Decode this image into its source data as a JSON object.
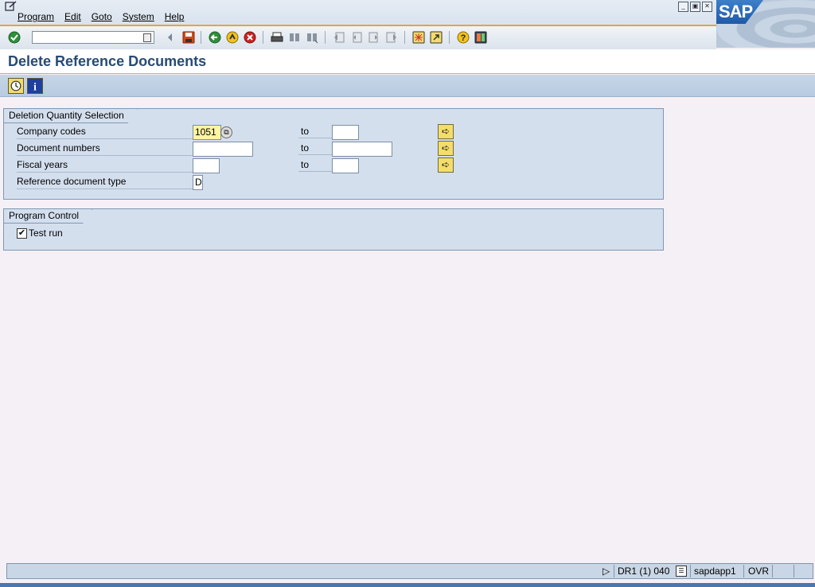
{
  "menu": {
    "items": [
      "Program",
      "Edit",
      "Goto",
      "System",
      "Help"
    ]
  },
  "logo": {
    "text": "SAP"
  },
  "toolbar": {
    "command_field_value": "",
    "icons": [
      "enter-icon",
      "back-arrow-icon",
      "save-icon",
      "back-icon",
      "exit-icon",
      "cancel-icon",
      "print-icon",
      "find-icon",
      "find-next-icon",
      "first-page-icon",
      "previous-page-icon",
      "next-page-icon",
      "last-page-icon",
      "create-session-icon",
      "shortcut-icon",
      "help-icon",
      "layout-menu-icon"
    ]
  },
  "page": {
    "title": "Delete Reference Documents"
  },
  "app_toolbar": {
    "icons": [
      "execute-icon",
      "info-icon"
    ]
  },
  "selection": {
    "title": "Deletion Quantity Selection",
    "rows": [
      {
        "label": "Company codes",
        "from": "1051",
        "to_label": "to",
        "to": ""
      },
      {
        "label": "Document numbers",
        "from": "",
        "to_label": "to",
        "to": ""
      },
      {
        "label": "Fiscal years",
        "from": "",
        "to_label": "to",
        "to": ""
      },
      {
        "label": "Reference document type",
        "value": "D"
      }
    ]
  },
  "program_control": {
    "title": "Program Control",
    "test_run_label": "Test run",
    "test_run_checked": true,
    "check_mark": "✔"
  },
  "statusbar": {
    "system": "DR1 (1) 040",
    "server": "sapdapp1",
    "mode": "OVR"
  }
}
